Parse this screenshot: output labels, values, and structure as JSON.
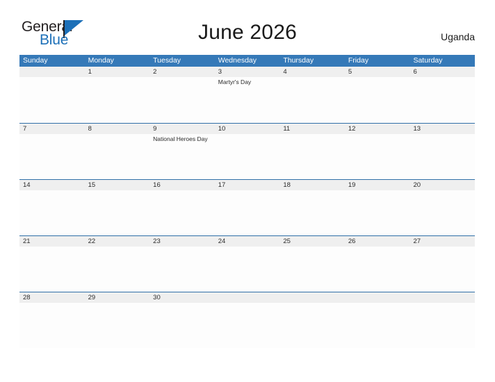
{
  "brand": {
    "name_part1": "General",
    "name_part2": "Blue",
    "logo_icon": "flag-triangle-icon"
  },
  "header": {
    "title": "June 2026",
    "country": "Uganda"
  },
  "colors": {
    "header_blue": "#3579b8",
    "row_divider_blue": "#2f6fa8",
    "date_band_gray": "#efefef",
    "brand_blue": "#1d70b8",
    "text_dark": "#231f20"
  },
  "calendar": {
    "weekdays": [
      "Sunday",
      "Monday",
      "Tuesday",
      "Wednesday",
      "Thursday",
      "Friday",
      "Saturday"
    ],
    "weeks": [
      [
        {
          "date": "",
          "events": []
        },
        {
          "date": "1",
          "events": []
        },
        {
          "date": "2",
          "events": []
        },
        {
          "date": "3",
          "events": [
            "Martyr's Day"
          ]
        },
        {
          "date": "4",
          "events": []
        },
        {
          "date": "5",
          "events": []
        },
        {
          "date": "6",
          "events": []
        }
      ],
      [
        {
          "date": "7",
          "events": []
        },
        {
          "date": "8",
          "events": []
        },
        {
          "date": "9",
          "events": [
            "National Heroes Day"
          ]
        },
        {
          "date": "10",
          "events": []
        },
        {
          "date": "11",
          "events": []
        },
        {
          "date": "12",
          "events": []
        },
        {
          "date": "13",
          "events": []
        }
      ],
      [
        {
          "date": "14",
          "events": []
        },
        {
          "date": "15",
          "events": []
        },
        {
          "date": "16",
          "events": []
        },
        {
          "date": "17",
          "events": []
        },
        {
          "date": "18",
          "events": []
        },
        {
          "date": "19",
          "events": []
        },
        {
          "date": "20",
          "events": []
        }
      ],
      [
        {
          "date": "21",
          "events": []
        },
        {
          "date": "22",
          "events": []
        },
        {
          "date": "23",
          "events": []
        },
        {
          "date": "24",
          "events": []
        },
        {
          "date": "25",
          "events": []
        },
        {
          "date": "26",
          "events": []
        },
        {
          "date": "27",
          "events": []
        }
      ],
      [
        {
          "date": "28",
          "events": []
        },
        {
          "date": "29",
          "events": []
        },
        {
          "date": "30",
          "events": []
        },
        {
          "date": "",
          "events": []
        },
        {
          "date": "",
          "events": []
        },
        {
          "date": "",
          "events": []
        },
        {
          "date": "",
          "events": []
        }
      ]
    ]
  }
}
